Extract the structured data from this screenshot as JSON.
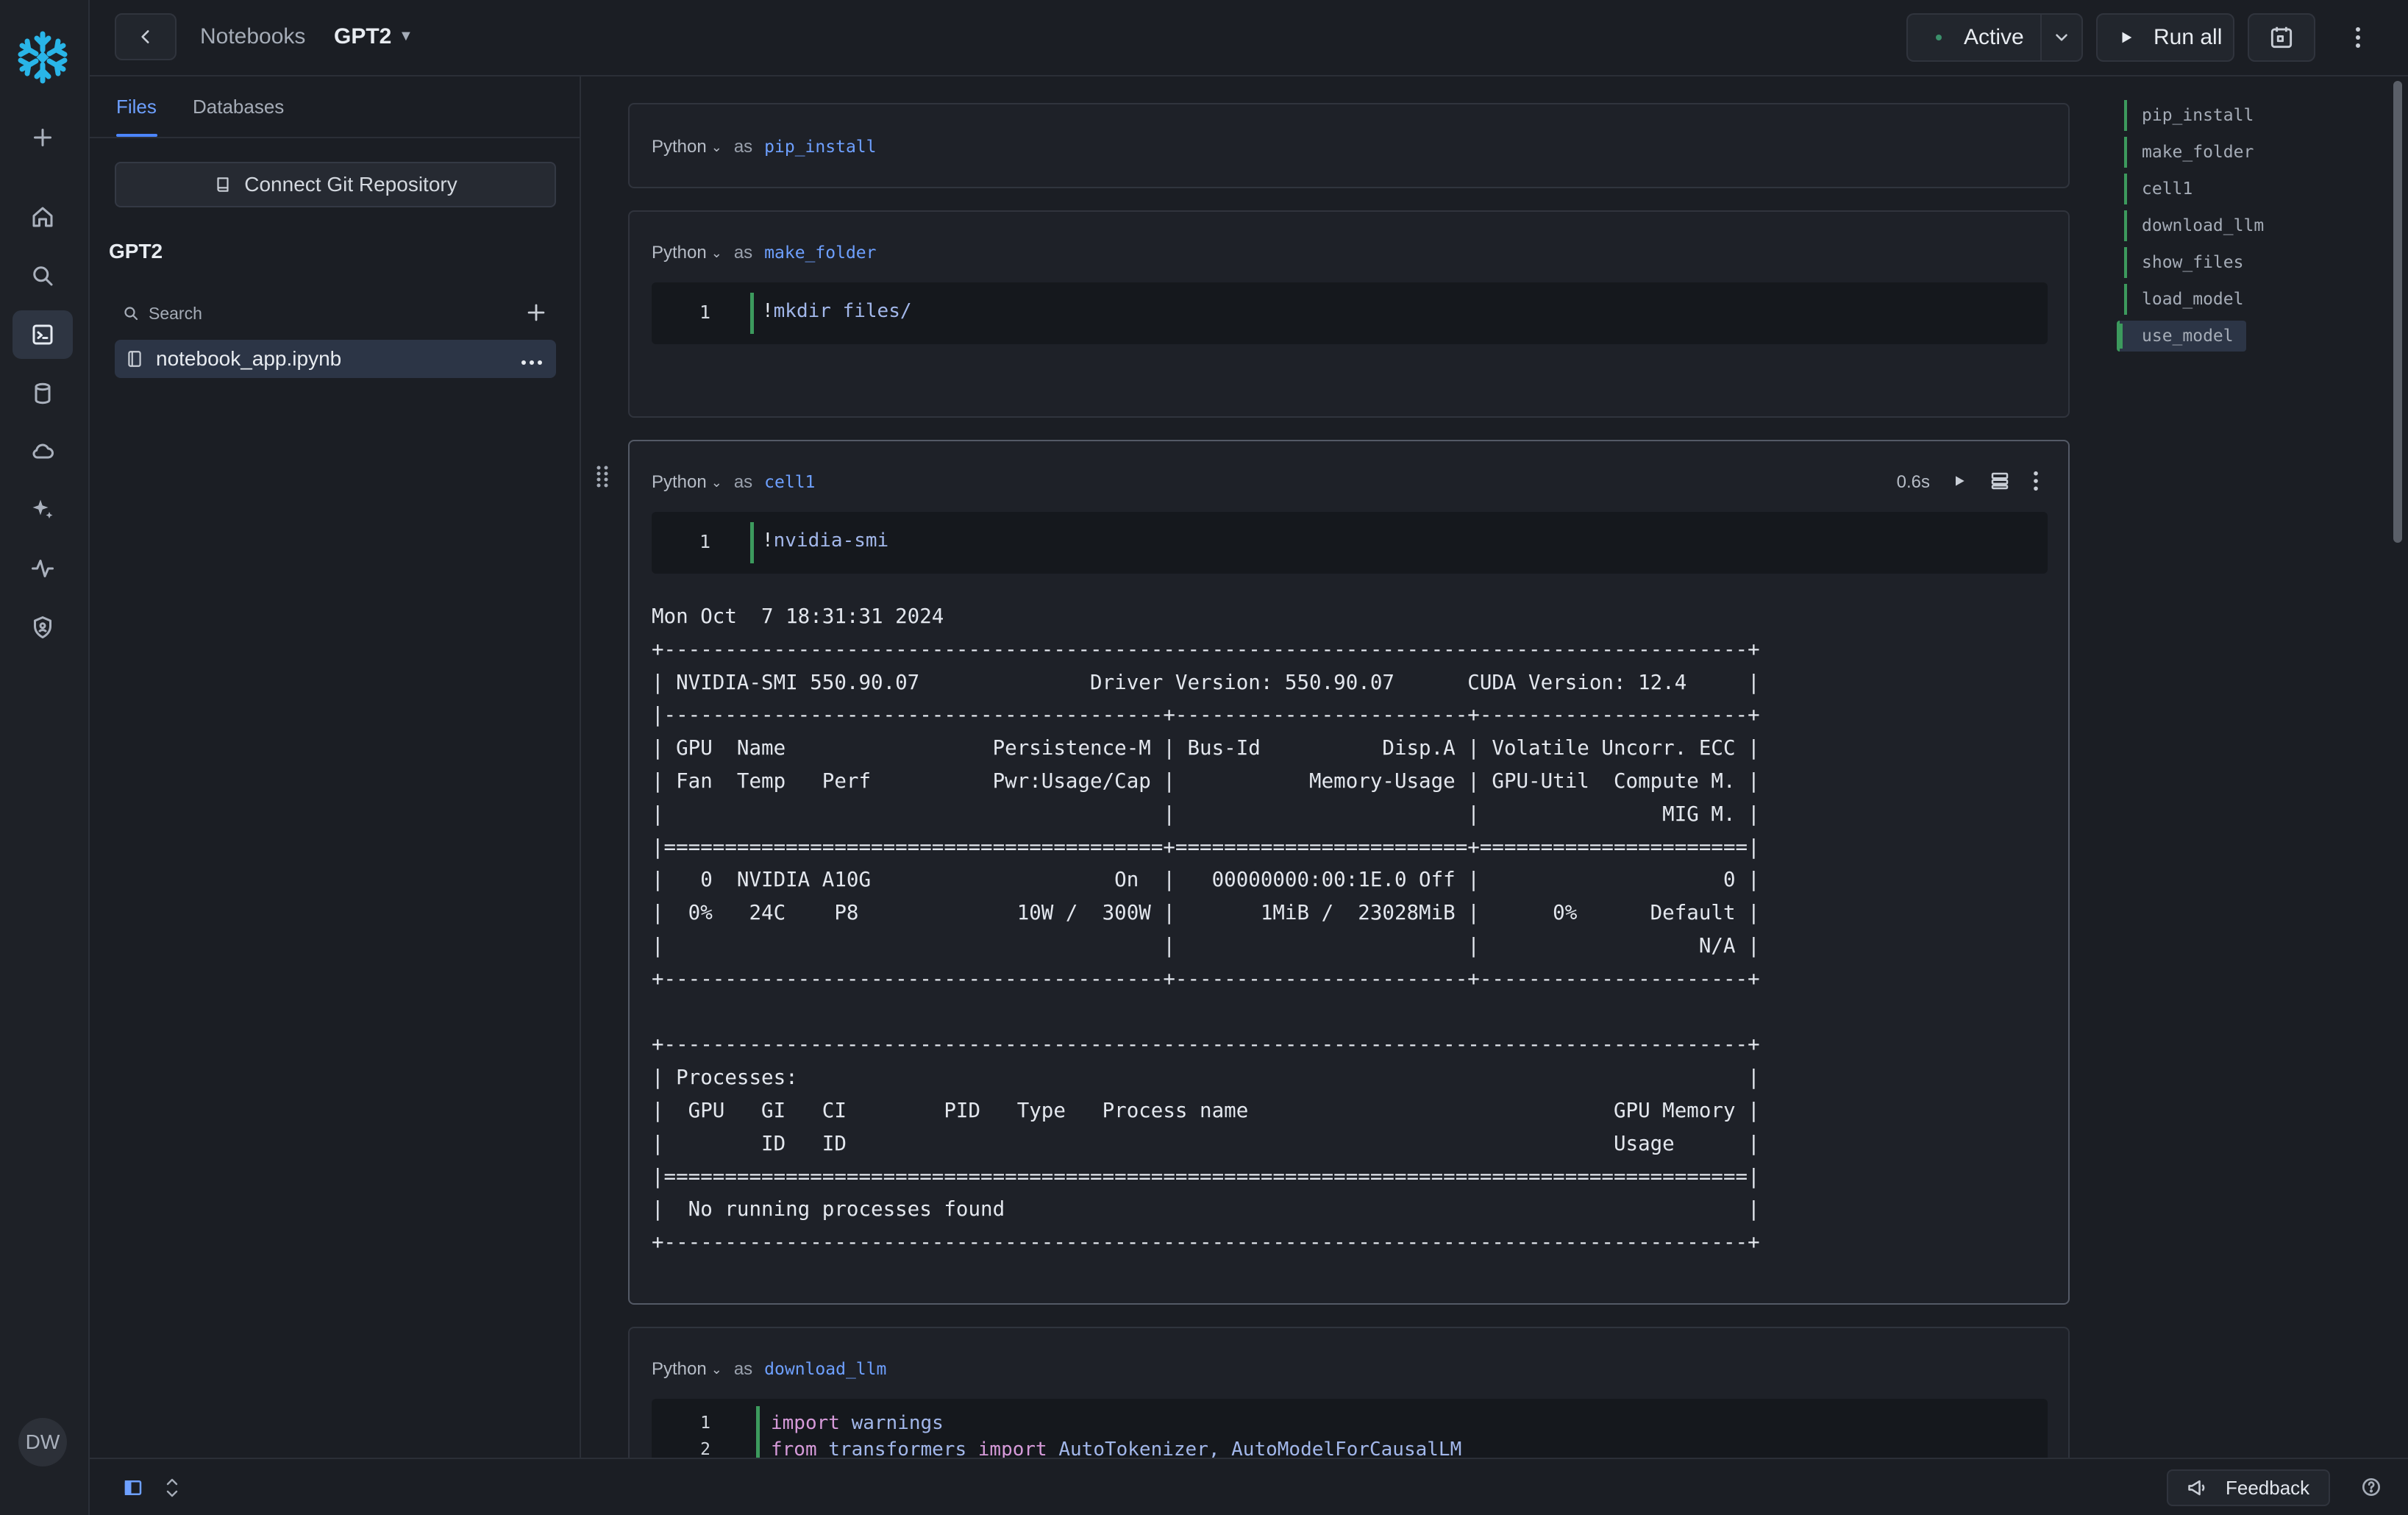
{
  "header": {
    "breadcrumb_root": "Notebooks",
    "notebook_name": "GPT2",
    "status_label": "Active",
    "run_all_label": "Run all"
  },
  "rail": {
    "icons": [
      "snowflake-logo",
      "plus-icon",
      "home-icon",
      "search-icon",
      "notebook-icon",
      "database-icon",
      "cloud-icon",
      "sparkle-icon",
      "activity-icon",
      "shield-icon"
    ],
    "avatar_initials": "DW"
  },
  "filepanel": {
    "tabs": [
      "Files",
      "Databases"
    ],
    "active_tab": "Files",
    "git_button_label": "Connect Git Repository",
    "folder_title": "GPT2",
    "search_placeholder": "Search",
    "files": [
      {
        "name": "notebook_app.ipynb"
      }
    ]
  },
  "cells": [
    {
      "language": "Python",
      "as_label": "as",
      "name": "pip_install"
    },
    {
      "language": "Python",
      "as_label": "as",
      "name": "make_folder",
      "lines": [
        {
          "num": "1",
          "code": "!mkdir files/"
        }
      ]
    },
    {
      "language": "Python",
      "as_label": "as",
      "name": "cell1",
      "exec_time": "0.6s",
      "lines": [
        {
          "num": "1",
          "code": "!nvidia-smi"
        }
      ],
      "output": [
        "Mon Oct  7 18:31:31 2024",
        "+-----------------------------------------------------------------------------------------+",
        "| NVIDIA-SMI 550.90.07              Driver Version: 550.90.07      CUDA Version: 12.4     |",
        "|-----------------------------------------+------------------------+----------------------+",
        "| GPU  Name                 Persistence-M | Bus-Id          Disp.A | Volatile Uncorr. ECC |",
        "| Fan  Temp   Perf          Pwr:Usage/Cap |           Memory-Usage | GPU-Util  Compute M. |",
        "|                                         |                        |               MIG M. |",
        "|=========================================+========================+======================|",
        "|   0  NVIDIA A10G                    On  |   00000000:00:1E.0 Off |                    0 |",
        "|  0%   24C    P8             10W /  300W |       1MiB /  23028MiB |      0%      Default |",
        "|                                         |                        |                  N/A |",
        "+-----------------------------------------+------------------------+----------------------+",
        "",
        "+-----------------------------------------------------------------------------------------+",
        "| Processes:                                                                              |",
        "|  GPU   GI   CI        PID   Type   Process name                              GPU Memory |",
        "|        ID   ID                                                               Usage      |",
        "|=========================================================================================|",
        "|  No running processes found                                                             |",
        "+-----------------------------------------------------------------------------------------+"
      ]
    },
    {
      "language": "Python",
      "as_label": "as",
      "name": "download_llm",
      "line1": {
        "num": "1",
        "kw": "import",
        "rest": " warnings"
      },
      "line2": {
        "num": "2",
        "kw1": "from",
        "mod": " transformers ",
        "kw2": "import",
        "rest": " AutoTokenizer, AutoModelForCausalLM"
      }
    }
  ],
  "outline": [
    "pip_install",
    "make_folder",
    "cell1",
    "download_llm",
    "show_files",
    "load_model",
    "use_model"
  ],
  "outline_active": "use_model",
  "footer": {
    "feedback_label": "Feedback"
  }
}
